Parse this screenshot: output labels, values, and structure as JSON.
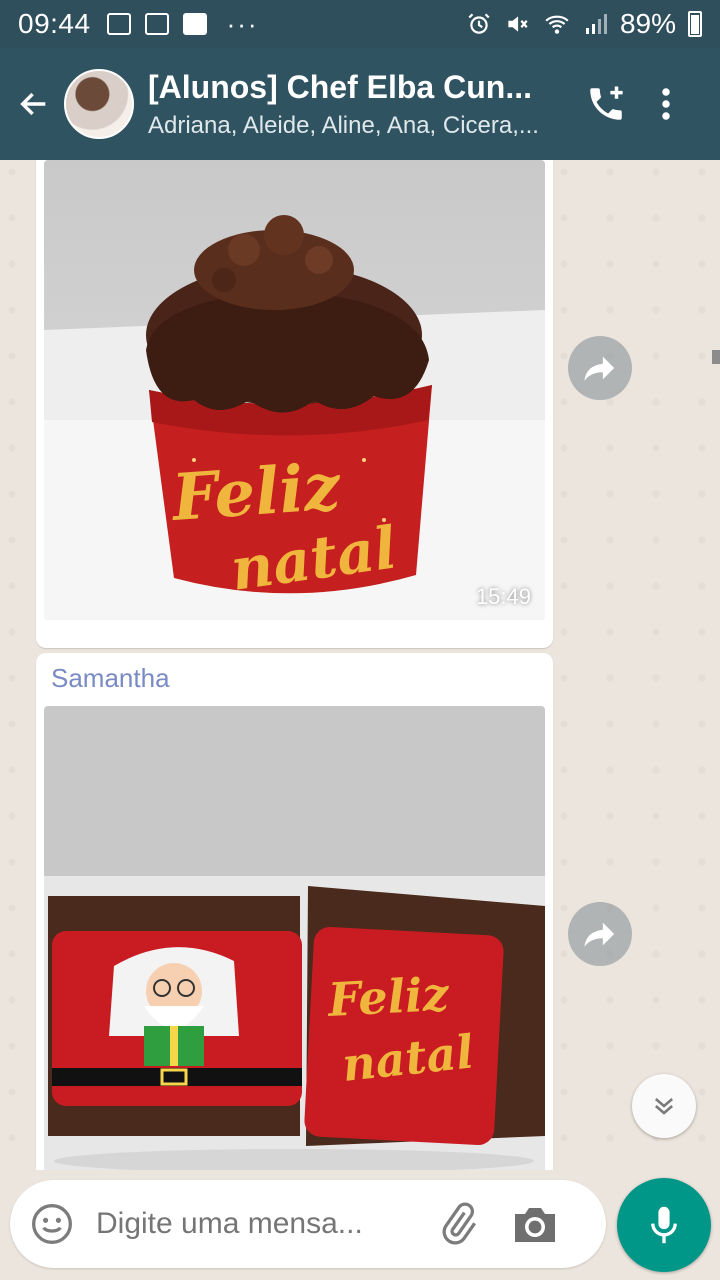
{
  "status_bar": {
    "time": "09:44",
    "battery": "89%",
    "left_icons": [
      "image-icon",
      "gmail-icon",
      "facebook-icon",
      "more-notifications-icon"
    ],
    "right_icons": [
      "alarm-icon",
      "mute-icon",
      "wifi-icon",
      "signal-icon",
      "battery-icon"
    ]
  },
  "header": {
    "title": "[Alunos] Chef Elba Cun...",
    "subtitle": "Adriana, Aleide, Aline, Ana, Cicera,..."
  },
  "messages": [
    {
      "type": "image",
      "content": "Chocolate-covered cake in red \"Feliz Natal\" cup",
      "time": "15:49"
    },
    {
      "type": "image",
      "sender": "Samantha",
      "content": "Wrapped brownies with Santa and \"Feliz Natal\" labels"
    }
  ],
  "input": {
    "placeholder": "Digite uma mensa..."
  },
  "colors": {
    "header_bg": "#2f5361",
    "status_bg": "#2f4f5c",
    "accent": "#009688",
    "sender_name": "#7a8ac5"
  }
}
